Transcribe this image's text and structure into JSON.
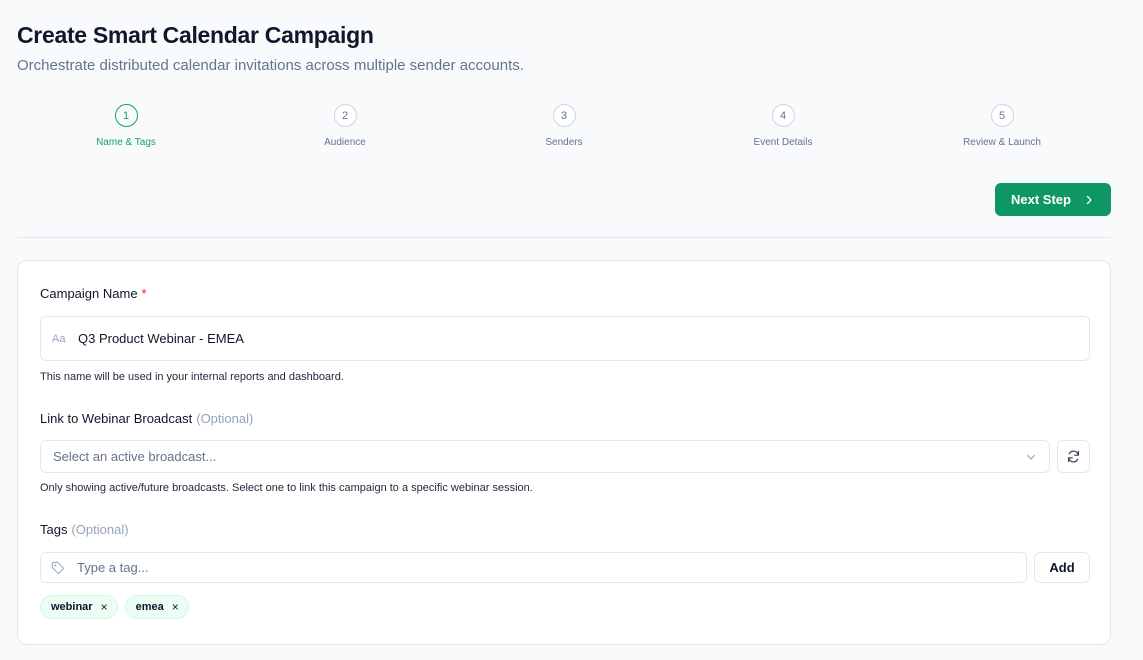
{
  "header": {
    "title": "Create Smart Calendar Campaign",
    "subtitle": "Orchestrate distributed calendar invitations across multiple sender accounts."
  },
  "stepper": {
    "steps": [
      {
        "number": "1",
        "label": "Name & Tags",
        "active": true
      },
      {
        "number": "2",
        "label": "Audience",
        "active": false
      },
      {
        "number": "3",
        "label": "Senders",
        "active": false
      },
      {
        "number": "4",
        "label": "Event Details",
        "active": false
      },
      {
        "number": "5",
        "label": "Review & Launch",
        "active": false
      }
    ]
  },
  "actions": {
    "next_label": "Next Step"
  },
  "form": {
    "campaign_name": {
      "label": "Campaign Name",
      "required_mark": "*",
      "icon": "Aa",
      "value": "Q3 Product Webinar - EMEA",
      "help": "This name will be used in your internal reports and dashboard."
    },
    "webinar": {
      "label": "Link to Webinar Broadcast",
      "optional": "(Optional)",
      "placeholder": "Select an active broadcast...",
      "help": "Only showing active/future broadcasts. Select one to link this campaign to a specific webinar session."
    },
    "tags": {
      "label": "Tags",
      "optional": "(Optional)",
      "placeholder": "Type a tag...",
      "add_label": "Add",
      "chips": [
        {
          "label": "webinar",
          "remove": "×"
        },
        {
          "label": "emea",
          "remove": "×"
        }
      ]
    }
  },
  "colors": {
    "accent": "#0e9765",
    "active_step": "#16a070",
    "chip_bg": "#ecfdf3",
    "required": "#dc2626"
  }
}
